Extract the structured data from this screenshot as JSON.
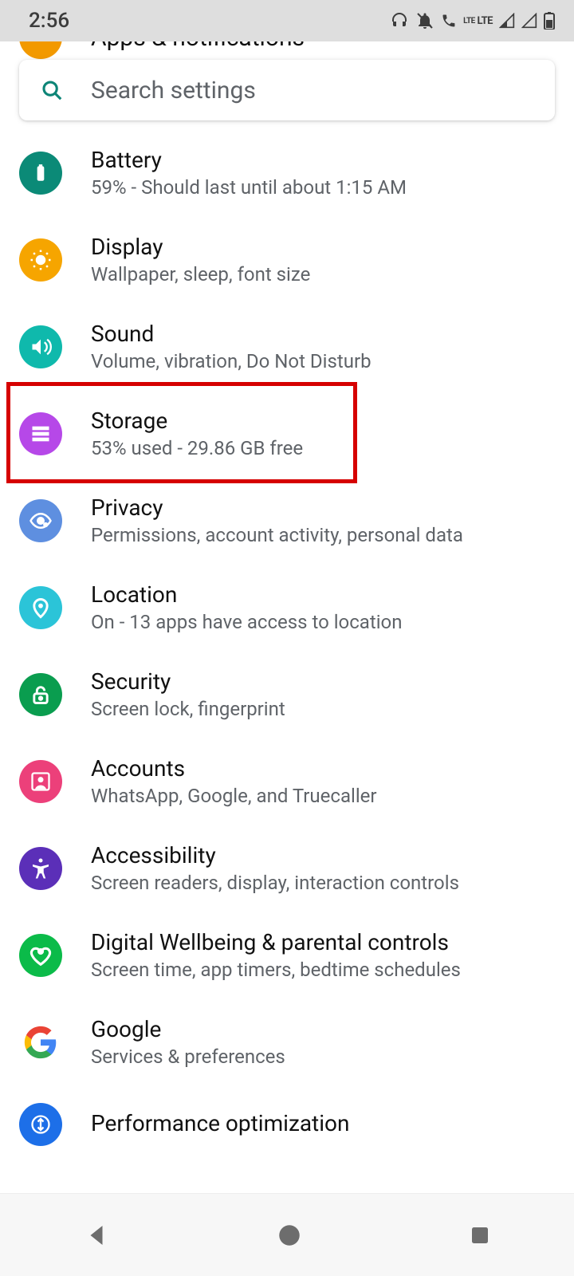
{
  "status": {
    "time": "2:56",
    "lte": "LTE"
  },
  "search": {
    "placeholder": "Search settings"
  },
  "peek": {
    "title": "Apps & notifications"
  },
  "items": [
    {
      "icon": "battery",
      "bg": "#0b8a77",
      "title": "Battery",
      "sub": "59% - Should last until about 1:15 AM"
    },
    {
      "icon": "display",
      "bg": "#f6a500",
      "title": "Display",
      "sub": "Wallpaper, sleep, font size"
    },
    {
      "icon": "sound",
      "bg": "#0fb9ac",
      "title": "Sound",
      "sub": "Volume, vibration, Do Not Disturb"
    },
    {
      "icon": "storage",
      "bg": "#b648e8",
      "title": "Storage",
      "sub": "53% used - 29.86 GB free"
    },
    {
      "icon": "privacy",
      "bg": "#5e8fe0",
      "title": "Privacy",
      "sub": "Permissions, account activity, personal data"
    },
    {
      "icon": "location",
      "bg": "#2bc4d8",
      "title": "Location",
      "sub": "On - 13 apps have access to location"
    },
    {
      "icon": "security",
      "bg": "#0a9d4f",
      "title": "Security",
      "sub": "Screen lock, fingerprint"
    },
    {
      "icon": "accounts",
      "bg": "#ec407a",
      "title": "Accounts",
      "sub": "WhatsApp, Google, and Truecaller"
    },
    {
      "icon": "accessibility",
      "bg": "#5b2fb8",
      "title": "Accessibility",
      "sub": "Screen readers, display, interaction controls"
    },
    {
      "icon": "wellbeing",
      "bg": "#0bbb49",
      "title": "Digital Wellbeing & parental controls",
      "sub": "Screen time, app timers, bedtime schedules"
    },
    {
      "icon": "google",
      "bg": "#ffffff",
      "title": "Google",
      "sub": "Services & preferences"
    },
    {
      "icon": "performance",
      "bg": "#1d6fe8",
      "title": "Performance optimization",
      "sub": ""
    }
  ],
  "highlight_index": 3
}
